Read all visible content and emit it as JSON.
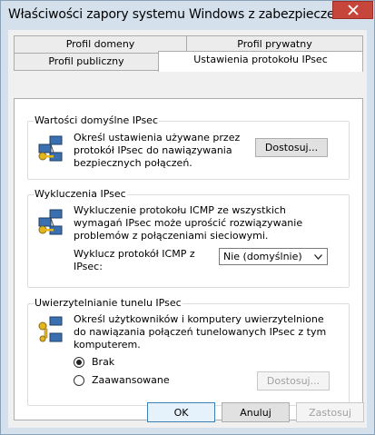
{
  "window": {
    "title": "Właściwości zapory systemu Windows z zabezpieczeni..."
  },
  "tabs": {
    "row1": [
      "Profil domeny",
      "Profil prywatny"
    ],
    "row2": [
      "Profil publiczny",
      "Ustawienia protokołu IPsec"
    ],
    "active": "Ustawienia protokołu IPsec"
  },
  "defaults": {
    "title": "Wartości domyślne IPsec",
    "description": "Określ ustawienia używane przez protokół IPsec do nawiązywania bezpiecznych połączeń.",
    "button": "Dostosuj..."
  },
  "exemptions": {
    "title": "Wykluczenia IPsec",
    "description": "Wykluczenie protokołu ICMP ze wszystkich wymagań IPsec może uprościć rozwiązywanie problemów z połączeniami sieciowymi.",
    "icmp_label": "Wyklucz protokół ICMP z IPsec:",
    "icmp_value": "Nie (domyślnie)"
  },
  "tunnel": {
    "title": "Uwierzytelnianie tunelu IPsec",
    "description": "Określ użytkowników i komputery uwierzytelnione do nawiązania połączeń tunelowanych IPsec z tym komputerem.",
    "option_none": "Brak",
    "option_advanced": "Zaawansowane",
    "selected": "Brak",
    "button": "Dostosuj..."
  },
  "footer": {
    "ok": "OK",
    "cancel": "Anuluj",
    "apply": "Zastosuj"
  },
  "icons": {
    "close": "close-icon",
    "network": "network-computers-icon",
    "key": "key-icon"
  },
  "colors": {
    "frame": "#d4e1ec",
    "close": "#c7463c",
    "focus": "#3c7fb1"
  }
}
